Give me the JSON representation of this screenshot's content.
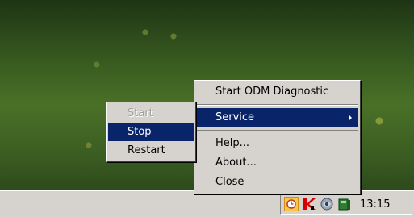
{
  "main_menu": {
    "items": [
      {
        "label": "Start ODM Diagnostic"
      },
      {
        "label": "Service"
      },
      {
        "label": "Help..."
      },
      {
        "label": "About..."
      },
      {
        "label": "Close"
      }
    ]
  },
  "service_submenu": {
    "items": [
      {
        "label": "Start"
      },
      {
        "label": "Stop"
      },
      {
        "label": "Restart"
      }
    ]
  },
  "tray": {
    "icons": [
      "clock-alarm-icon",
      "kaspersky-k-icon",
      "network-globe-icon",
      "odm-book-icon"
    ],
    "time": "13:15"
  },
  "colors": {
    "selection": "#0a246a",
    "menu_bg": "#d6d3ce",
    "taskbar_bg": "#d6d3ce"
  }
}
